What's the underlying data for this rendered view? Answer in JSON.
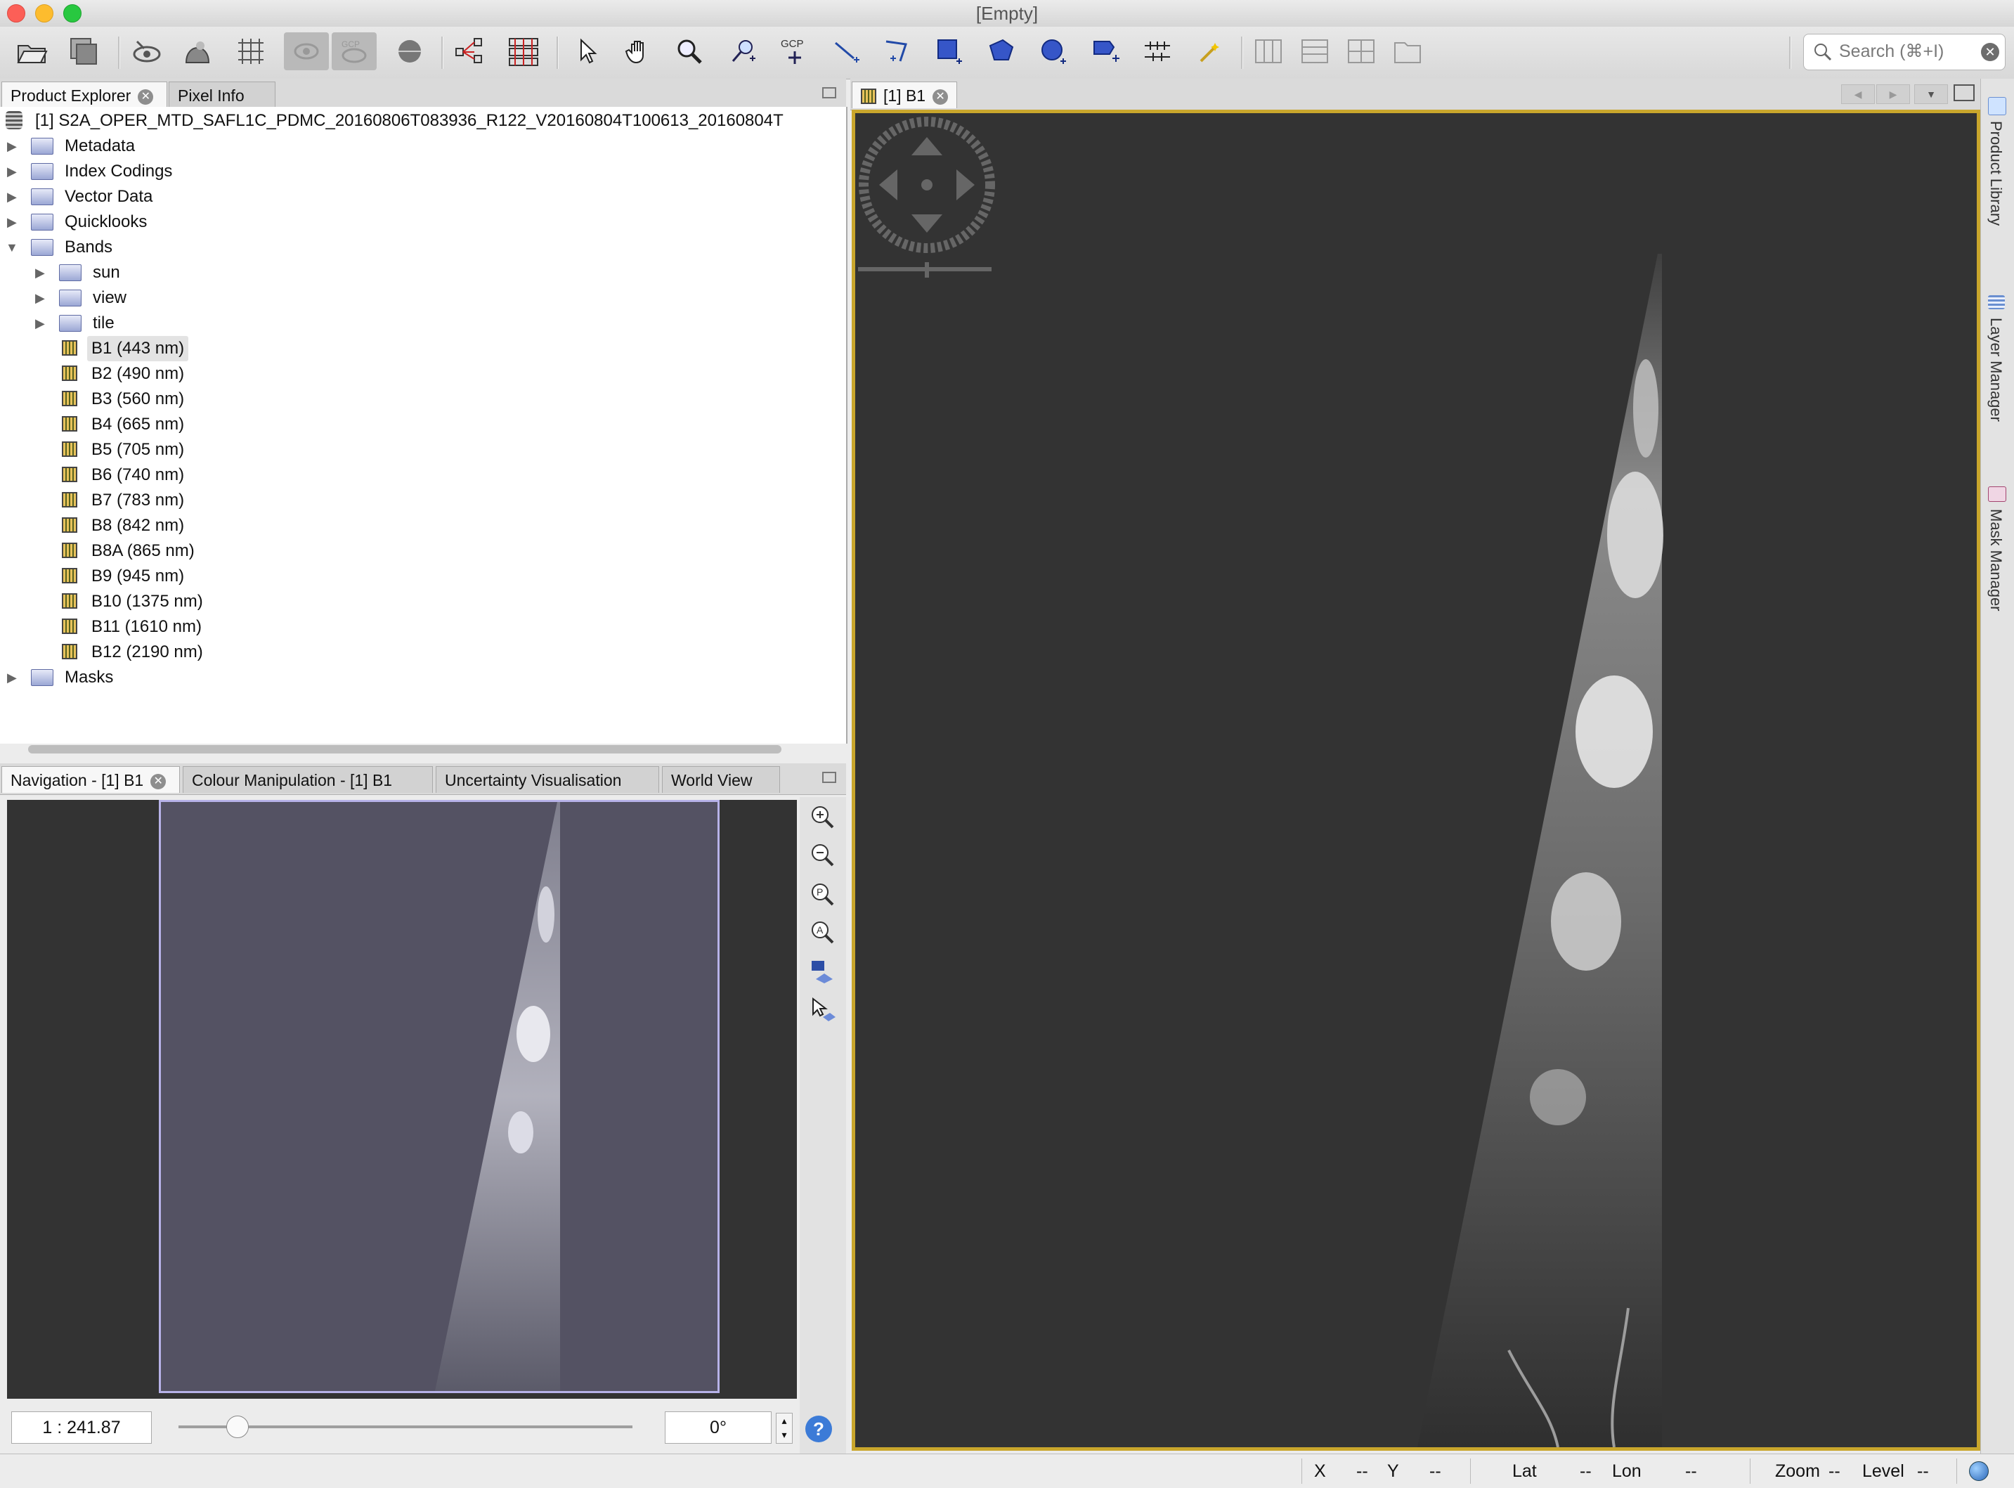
{
  "window": {
    "title": "[Empty]"
  },
  "colors": {
    "accent_frame": "#c9a62c",
    "nav_frame": "#b7b2e8",
    "image_bg": "#333333"
  },
  "toolbar": {
    "icons": [
      "open-product-icon",
      "save-product-icon",
      "show-pixel-icon",
      "show-world-icon",
      "graticule-icon",
      "overlay-disabled-icon",
      "overlay-gcp-disabled-icon",
      "sphere-icon",
      "pin-manager-icon",
      "gcp-manager-icon",
      "select-tool-icon",
      "pan-tool-icon",
      "zoom-tool-icon",
      "pin-placing-icon",
      "gcp-placing-icon",
      "line-drawing-icon",
      "polyline-drawing-icon",
      "rectangle-drawing-icon",
      "polygon-drawing-icon",
      "ellipse-drawing-icon",
      "range-finder-icon",
      "measure-icon",
      "magic-wand-icon",
      "tile-horizontal-icon",
      "tile-vertical-icon",
      "tile-grid-icon",
      "tile-evenly-icon"
    ],
    "gcp_label": "GCP",
    "search_placeholder": "Search (⌘+I)"
  },
  "product_explorer": {
    "tabs": [
      "Product Explorer",
      "Pixel Info"
    ],
    "product_label": "[1] S2A_OPER_MTD_SAFL1C_PDMC_20160806T083936_R122_V20160804T100613_20160804T",
    "groups": [
      "Metadata",
      "Index Codings",
      "Vector Data",
      "Quicklooks",
      "Bands"
    ],
    "band_folders": [
      "sun",
      "view",
      "tile"
    ],
    "bands": [
      "B1 (443 nm)",
      "B2 (490 nm)",
      "B3 (560 nm)",
      "B4 (665 nm)",
      "B5 (705 nm)",
      "B6 (740 nm)",
      "B7 (783 nm)",
      "B8 (842 nm)",
      "B8A (865 nm)",
      "B9 (945 nm)",
      "B10 (1375 nm)",
      "B11 (1610 nm)",
      "B12 (2190 nm)"
    ],
    "selected_band": "B1 (443 nm)",
    "masks": "Masks"
  },
  "navigation": {
    "tabs": [
      "Navigation - [1] B1",
      "Colour Manipulation - [1] B1",
      "Uncertainty Visualisation",
      "World View"
    ],
    "scale": "1 : 241.87",
    "angle": "0°",
    "zoom_slider_fraction": 0.13,
    "tools": [
      "zoom-in-icon",
      "zoom-out-icon",
      "zoom-pixel-icon",
      "zoom-all-icon",
      "sync-views-icon",
      "sync-cursor-icon"
    ]
  },
  "image_view": {
    "tab": "[1] B1"
  },
  "side_tabs": [
    "Product Library",
    "Layer Manager",
    "Mask Manager"
  ],
  "status": {
    "x_label": "X",
    "x_val": "--",
    "y_label": "Y",
    "y_val": "--",
    "lat_label": "Lat",
    "lat_val": "--",
    "lon_label": "Lon",
    "lon_val": "--",
    "zoom_label": "Zoom",
    "zoom_val": "--",
    "level_label": "Level",
    "level_val": "--"
  }
}
